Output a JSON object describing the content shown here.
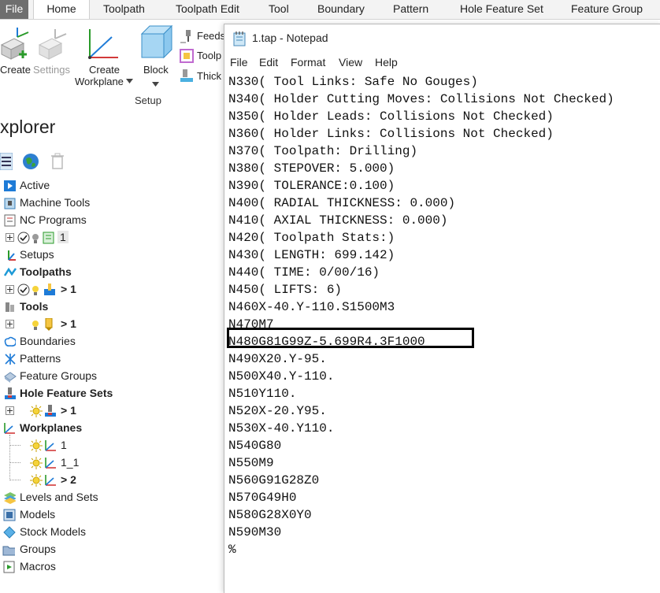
{
  "ribbon": {
    "tabs": [
      "File",
      "Home",
      "Toolpath",
      "Toolpath Edit",
      "Tool",
      "Boundary",
      "Pattern",
      "Hole Feature Set",
      "Feature Group"
    ],
    "create_label": "Create",
    "settings_label": "Settings",
    "create_workplane_line1": "Create",
    "create_workplane_line2": "Workplane",
    "block_label": "Block",
    "feeds_label": "Feeds",
    "toolp_label": "Toolp",
    "thick_label": "Thick",
    "setup_group_label": "Setup"
  },
  "explorer": {
    "title": "xplorer",
    "items": [
      {
        "label": "Active",
        "bold": false,
        "icon": "active-icon"
      },
      {
        "label": "Machine Tools",
        "bold": false,
        "icon": "machine-tools-icon"
      },
      {
        "label": "NC Programs",
        "bold": false,
        "icon": "nc-programs-icon"
      },
      {
        "label": "1",
        "bold": false,
        "icon": "nc-program-icon"
      },
      {
        "label": "Setups",
        "bold": false,
        "icon": "setups-icon"
      },
      {
        "label": "Toolpaths",
        "bold": true,
        "icon": "toolpaths-icon"
      },
      {
        "label": "> 1",
        "bold": true,
        "icon": "toolpath-item-icon"
      },
      {
        "label": "Tools",
        "bold": true,
        "icon": "tools-icon"
      },
      {
        "label": "> 1",
        "bold": true,
        "icon": "tool-item-icon"
      },
      {
        "label": "Boundaries",
        "bold": false,
        "icon": "boundaries-icon"
      },
      {
        "label": "Patterns",
        "bold": false,
        "icon": "patterns-icon"
      },
      {
        "label": "Feature Groups",
        "bold": false,
        "icon": "feature-groups-icon"
      },
      {
        "label": "Hole Feature Sets",
        "bold": true,
        "icon": "hole-feature-sets-icon"
      },
      {
        "label": "> 1",
        "bold": true,
        "icon": "hole-feature-item-icon"
      },
      {
        "label": "Workplanes",
        "bold": true,
        "icon": "workplanes-icon"
      },
      {
        "label": "1",
        "bold": false,
        "icon": "workplane-item-icon"
      },
      {
        "label": "1_1",
        "bold": false,
        "icon": "workplane-item-icon"
      },
      {
        "label": "> 2",
        "bold": true,
        "icon": "workplane-item-icon"
      },
      {
        "label": "Levels and Sets",
        "bold": false,
        "icon": "levels-sets-icon"
      },
      {
        "label": "Models",
        "bold": false,
        "icon": "models-icon"
      },
      {
        "label": "Stock Models",
        "bold": false,
        "icon": "stock-models-icon"
      },
      {
        "label": "Groups",
        "bold": false,
        "icon": "groups-icon"
      },
      {
        "label": "Macros",
        "bold": false,
        "icon": "macros-icon"
      }
    ]
  },
  "notepad": {
    "title": "1.tap - Notepad",
    "menu": [
      "File",
      "Edit",
      "Format",
      "View",
      "Help"
    ],
    "lines": [
      "N330( Tool Links: Safe No Gouges)",
      "N340( Holder Cutting Moves: Collisions Not Checked)",
      "N350( Holder Leads: Collisions Not Checked)",
      "N360( Holder Links: Collisions Not Checked)",
      "N370( Toolpath: Drilling)",
      "N380( STEPOVER: 5.000)",
      "N390( TOLERANCE:0.100)",
      "N400( RADIAL THICKNESS: 0.000)",
      "N410( AXIAL THICKNESS: 0.000)",
      "N420( Toolpath Stats:)",
      "N430( LENGTH: 699.142)",
      "N440( TIME: 0/00/16)",
      "N450( LIFTS: 6)",
      "N460X-40.Y-110.S1500M3",
      "N470M7",
      "N480G81G99Z-5.699R4.3F1000",
      "N490X20.Y-95.",
      "N500X40.Y-110.",
      "N510Y110.",
      "N520X-20.Y95.",
      "N530X-40.Y110.",
      "N540G80",
      "N550M9",
      "N560G91G28Z0",
      "N570G49H0",
      "N580G28X0Y0",
      "N590M30",
      "%"
    ]
  }
}
